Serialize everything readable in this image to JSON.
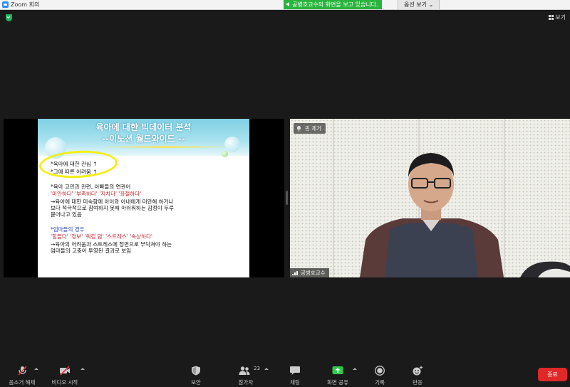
{
  "titlebar": {
    "app_title": "Zoom 회의"
  },
  "share_banner": {
    "text": "공병호교수의 화면을 보고 있습니다."
  },
  "view_options": {
    "label": "옵션 보기",
    "chevron": "⌄"
  },
  "view_button": {
    "label": "보기",
    "icon": "grid-icon"
  },
  "slide": {
    "title_line1": "육아에 대한 빅데이터 분석",
    "title_line2": "--이노션 월드와이드 --",
    "lines": [
      "*육아에 대한 관심 ↑",
      "*그에 따른 어려움 ↑",
      "*육아 고민과 관련, 아빠들의 연관어",
      "'미안하다' '부족하다' '지치다' '좌절하다'",
      "→육아에 대한 미숙함에 아이와 아내에게 미안해 하거나",
      "보다 적극적으로 참여하지 못해 아쉬워하는 감정이 두루",
      "묻어나고 있음",
      "*엄마들의 경우",
      "'힘들다' '정보' '워킹 맘' '스트레스' '속상하다'",
      "→육아의 어려움과 스트레스에 정면으로 부닥쳐야 하는",
      "엄마들의 고충이 투영된 결과로 보임"
    ]
  },
  "right_tile": {
    "pin_label": "핀 제거",
    "participant_name": "공병호교수"
  },
  "toolbar": {
    "items": [
      {
        "label": "음소거 해제",
        "icon": "microphone-muted-icon"
      },
      {
        "label": "비디오 시작",
        "icon": "video-off-icon"
      },
      {
        "label": "보안",
        "icon": "shield-icon"
      },
      {
        "label": "참가자",
        "icon": "participants-icon",
        "count": "23"
      },
      {
        "label": "채팅",
        "icon": "chat-icon"
      },
      {
        "label": "화면 공유",
        "icon": "share-screen-icon"
      },
      {
        "label": "기록",
        "icon": "record-icon"
      },
      {
        "label": "반응",
        "icon": "reaction-icon"
      }
    ],
    "end_label": "종료"
  },
  "colors": {
    "share_green": "#28b43c",
    "end_red": "#e02828",
    "background": "#1a1a1a"
  }
}
